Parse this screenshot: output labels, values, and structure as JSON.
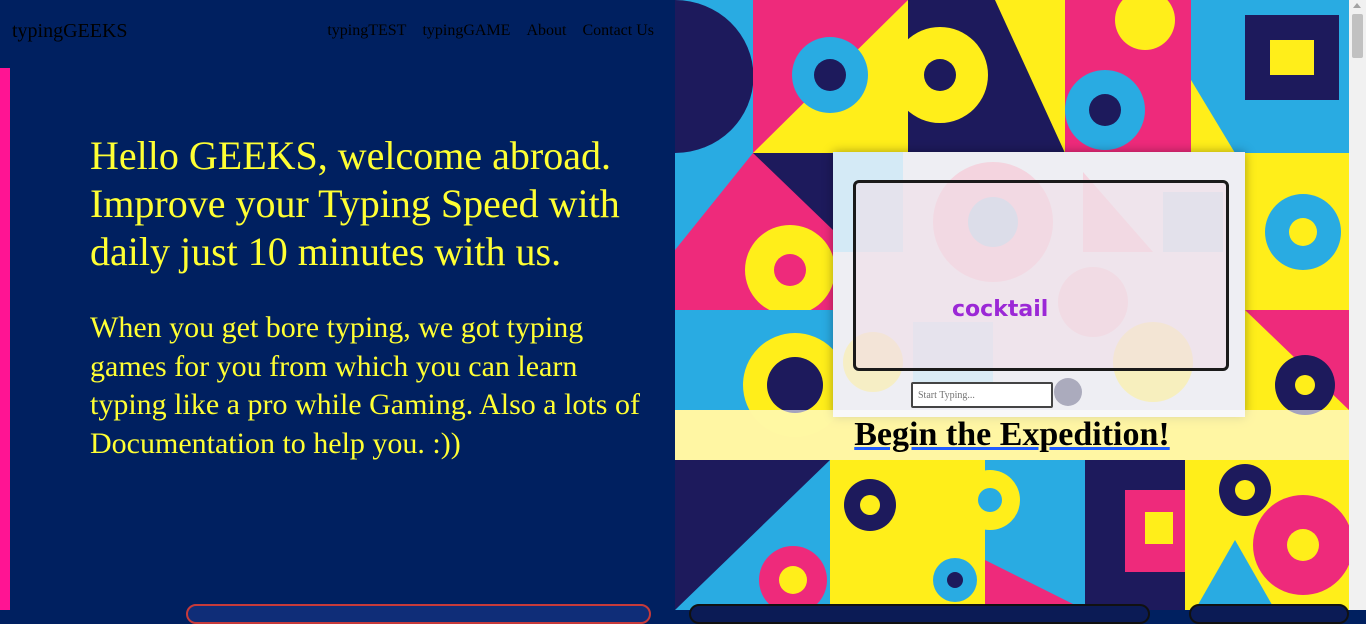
{
  "header": {
    "brand": "typingGEEKS",
    "nav": [
      "typingTEST",
      "typingGAME",
      "About",
      "Contact Us"
    ]
  },
  "hero": {
    "headline": "Hello GEEKS, welcome abroad. Improve your Typing Speed with daily just 10 minutes with us.",
    "subtext": "When you get bore typing, we got typing games for you from which you can learn typing like a pro while Gaming. Also a lots of Documentation to help you. :))"
  },
  "preview": {
    "word": "cocktail",
    "input_placeholder": "Start Typing..."
  },
  "cta": {
    "label": "Begin the Expedition!"
  },
  "colors": {
    "background": "#002060",
    "accent_text": "#ffff33",
    "accent_bar": "#ff1493",
    "pattern_blue": "#29abe2",
    "pattern_pink": "#ee2a7b",
    "pattern_yellow": "#ffee1a",
    "pattern_navy": "#1d1a5c"
  }
}
